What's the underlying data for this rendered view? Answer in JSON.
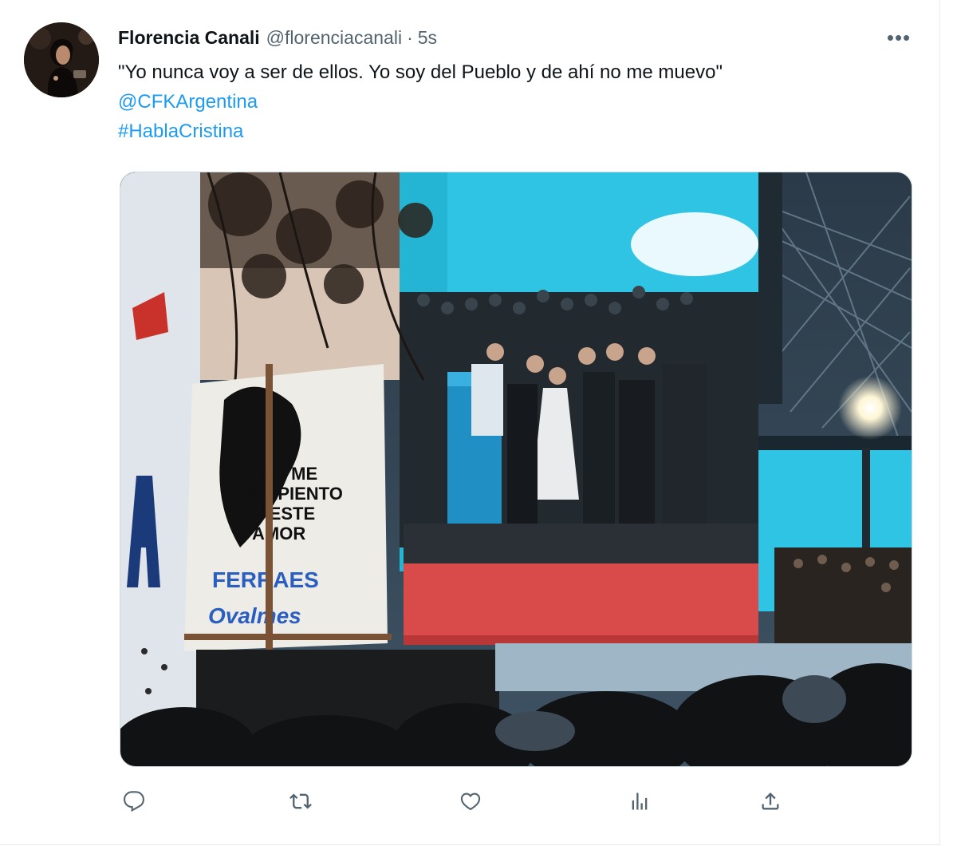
{
  "tweet": {
    "author": {
      "display_name": "Florencia Canali",
      "handle": "@florenciacanali",
      "separator": "·",
      "timestamp": "5s"
    },
    "more_label": "•••",
    "text": "\"Yo nunca voy a ser de ellos. Yo soy del Pueblo y de ahí no me muevo\"",
    "mention": "@CFKArgentina",
    "hashtag": "#HablaCristina",
    "media": {
      "banner_lines": [
        "NO ME",
        "ARREPIENTO",
        "DE ESTE",
        "AMOR"
      ],
      "banner_lines2": [
        "FERRAES",
        "Ovalmes"
      ]
    },
    "actions": [
      {
        "name": "reply",
        "icon": "reply-icon"
      },
      {
        "name": "retweet",
        "icon": "retweet-icon"
      },
      {
        "name": "like",
        "icon": "heart-icon"
      },
      {
        "name": "views",
        "icon": "analytics-icon"
      },
      {
        "name": "share",
        "icon": "share-icon"
      }
    ]
  },
  "colors": {
    "text": "#0f1419",
    "muted": "#536471",
    "link": "#1d9bf0",
    "screen_cyan": "#2fc4e3",
    "stage_red": "#d94a4a"
  }
}
